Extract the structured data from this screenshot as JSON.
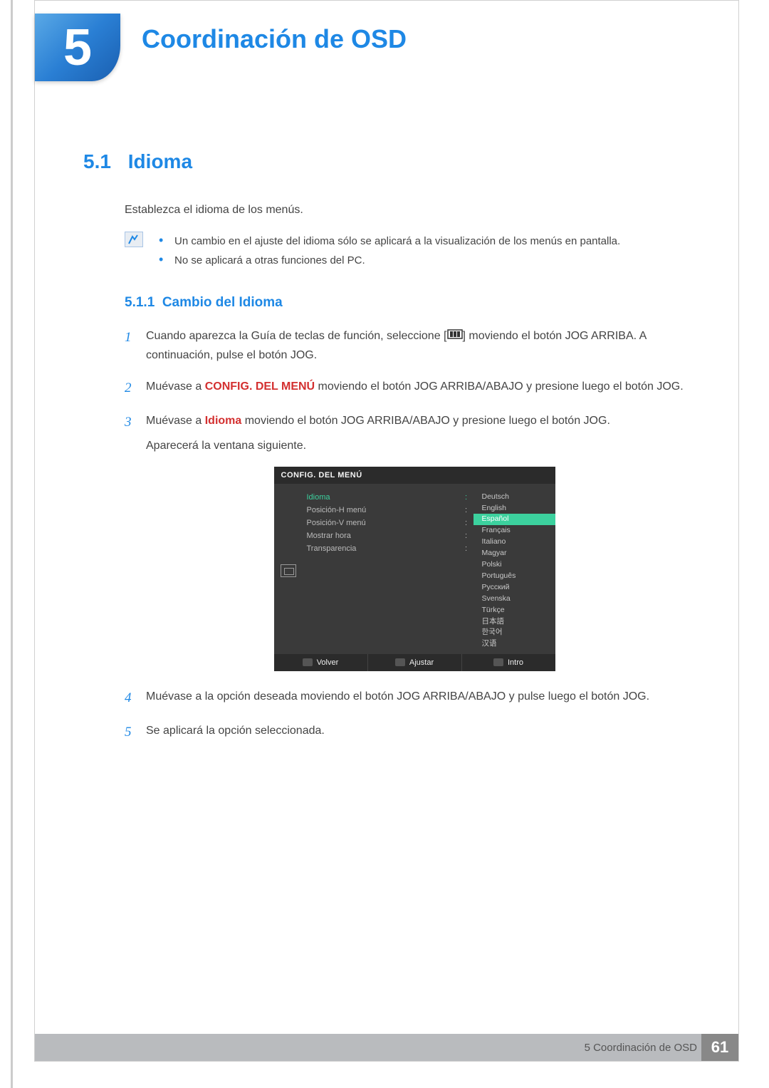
{
  "chapter": {
    "number": "5",
    "title": "Coordinación de OSD"
  },
  "section": {
    "number": "5.1",
    "title": "Idioma"
  },
  "intro_para": "Establezca el idioma de los menús.",
  "notes": [
    "Un cambio en el ajuste del idioma sólo se aplicará a la visualización de los menús en pantalla.",
    "No se aplicará a otras funciones del PC."
  ],
  "subsection": {
    "number": "5.1.1",
    "title": "Cambio del Idioma"
  },
  "steps": {
    "s1a": "Cuando aparezca la Guía de teclas de función, seleccione [",
    "s1b": "] moviendo el botón JOG ARRIBA. A continuación, pulse el botón JOG.",
    "s2a": "Muévase a ",
    "s2bold": "CONFIG. DEL MENÚ",
    "s2b": " moviendo el botón JOG ARRIBA/ABAJO y presione luego el botón JOG.",
    "s3a": "Muévase a ",
    "s3bold": "Idioma",
    "s3b": " moviendo el botón JOG ARRIBA/ABAJO y presione luego el botón JOG.",
    "s3c": "Aparecerá la ventana siguiente.",
    "s4": "Muévase a la opción deseada moviendo el botón JOG ARRIBA/ABAJO y pulse luego el botón JOG.",
    "s5": "Se aplicará la opción seleccionada."
  },
  "osd": {
    "title": "CONFIG. DEL MENÚ",
    "menu": [
      {
        "label": "Idioma",
        "active": true
      },
      {
        "label": "Posición-H menú"
      },
      {
        "label": "Posición-V menú"
      },
      {
        "label": "Mostrar hora"
      },
      {
        "label": "Transparencia"
      }
    ],
    "langs": [
      "Deutsch",
      "English",
      "Español",
      "Français",
      "Italiano",
      "Magyar",
      "Polski",
      "Português",
      "Русский",
      "Svenska",
      "Türkçe",
      "日本語",
      "한국어",
      "汉语"
    ],
    "selected_lang": "Español",
    "footer": {
      "back": "Volver",
      "adjust": "Ajustar",
      "enter": "Intro"
    }
  },
  "footer": {
    "label": "5 Coordinación de OSD",
    "page": "61"
  }
}
